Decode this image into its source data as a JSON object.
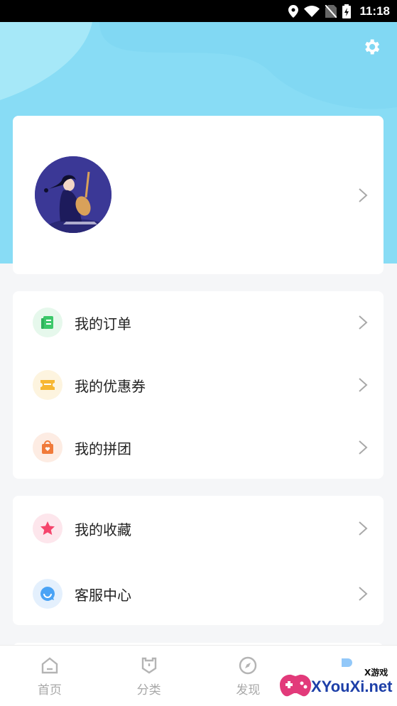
{
  "status_bar": {
    "time": "11:18",
    "icons": [
      "location-icon",
      "wifi-icon",
      "no-sim-icon",
      "battery-charging-icon"
    ]
  },
  "header": {
    "settings_icon": "gear-icon",
    "background_color": "#88e0f6"
  },
  "profile": {
    "avatar_icon": "avatar-lute-player-illustration"
  },
  "menu_group_1": [
    {
      "label": "我的订单",
      "icon": "order-icon",
      "icon_color": "#3cc86a",
      "icon_bg": "#e6f8ec"
    },
    {
      "label": "我的优惠券",
      "icon": "coupon-icon",
      "icon_color": "#f7b733",
      "icon_bg": "#fdf4df"
    },
    {
      "label": "我的拼团",
      "icon": "group-buy-bag-icon",
      "icon_color": "#f07a3a",
      "icon_bg": "#fdece3"
    }
  ],
  "menu_group_2": [
    {
      "label": "我的收藏",
      "icon": "star-icon",
      "icon_color": "#f5456c",
      "icon_bg": "#fde6ec"
    },
    {
      "label": "客服中心",
      "icon": "customer-service-chat-icon",
      "icon_color": "#4aa3f5",
      "icon_bg": "#e4f0fd"
    }
  ],
  "tab_bar": [
    {
      "label": "首页",
      "icon": "home-icon"
    },
    {
      "label": "分类",
      "icon": "category-icon"
    },
    {
      "label": "发现",
      "icon": "compass-icon"
    }
  ],
  "watermark": {
    "text": "XYouXi.net",
    "small_text": "X游戏"
  }
}
